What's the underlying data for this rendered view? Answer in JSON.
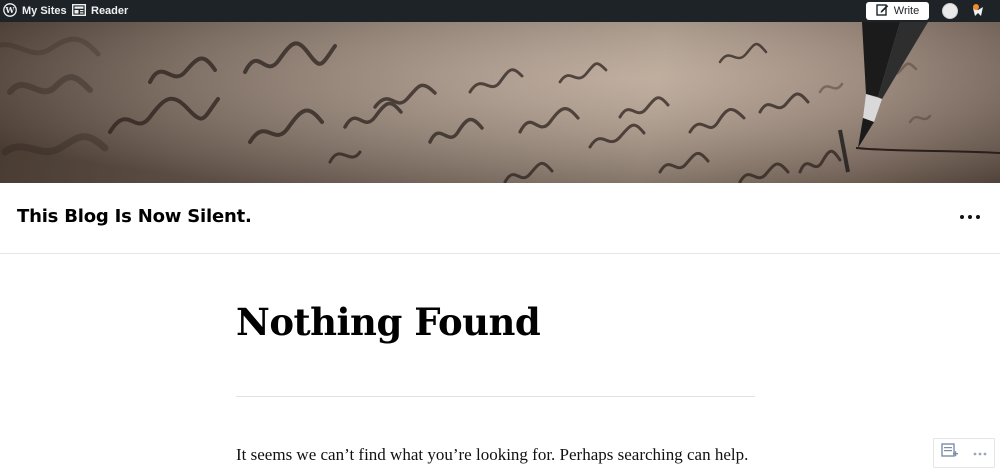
{
  "admin_bar": {
    "my_sites_label": "My Sites",
    "reader_label": "Reader",
    "write_label": "Write",
    "icons": [
      "wordpress-icon",
      "reader-icon",
      "write-icon",
      "avatar",
      "notifications-icon"
    ],
    "background": "#1d2327",
    "notification_dot_color": "#f08c2d"
  },
  "header": {
    "image_alt_description": "handwritten letter with fountain pen"
  },
  "site": {
    "title": "This Blog Is Now Silent."
  },
  "content": {
    "title": "Nothing Found",
    "message": "It seems we can’t find what you’re looking for. Perhaps searching can help."
  }
}
